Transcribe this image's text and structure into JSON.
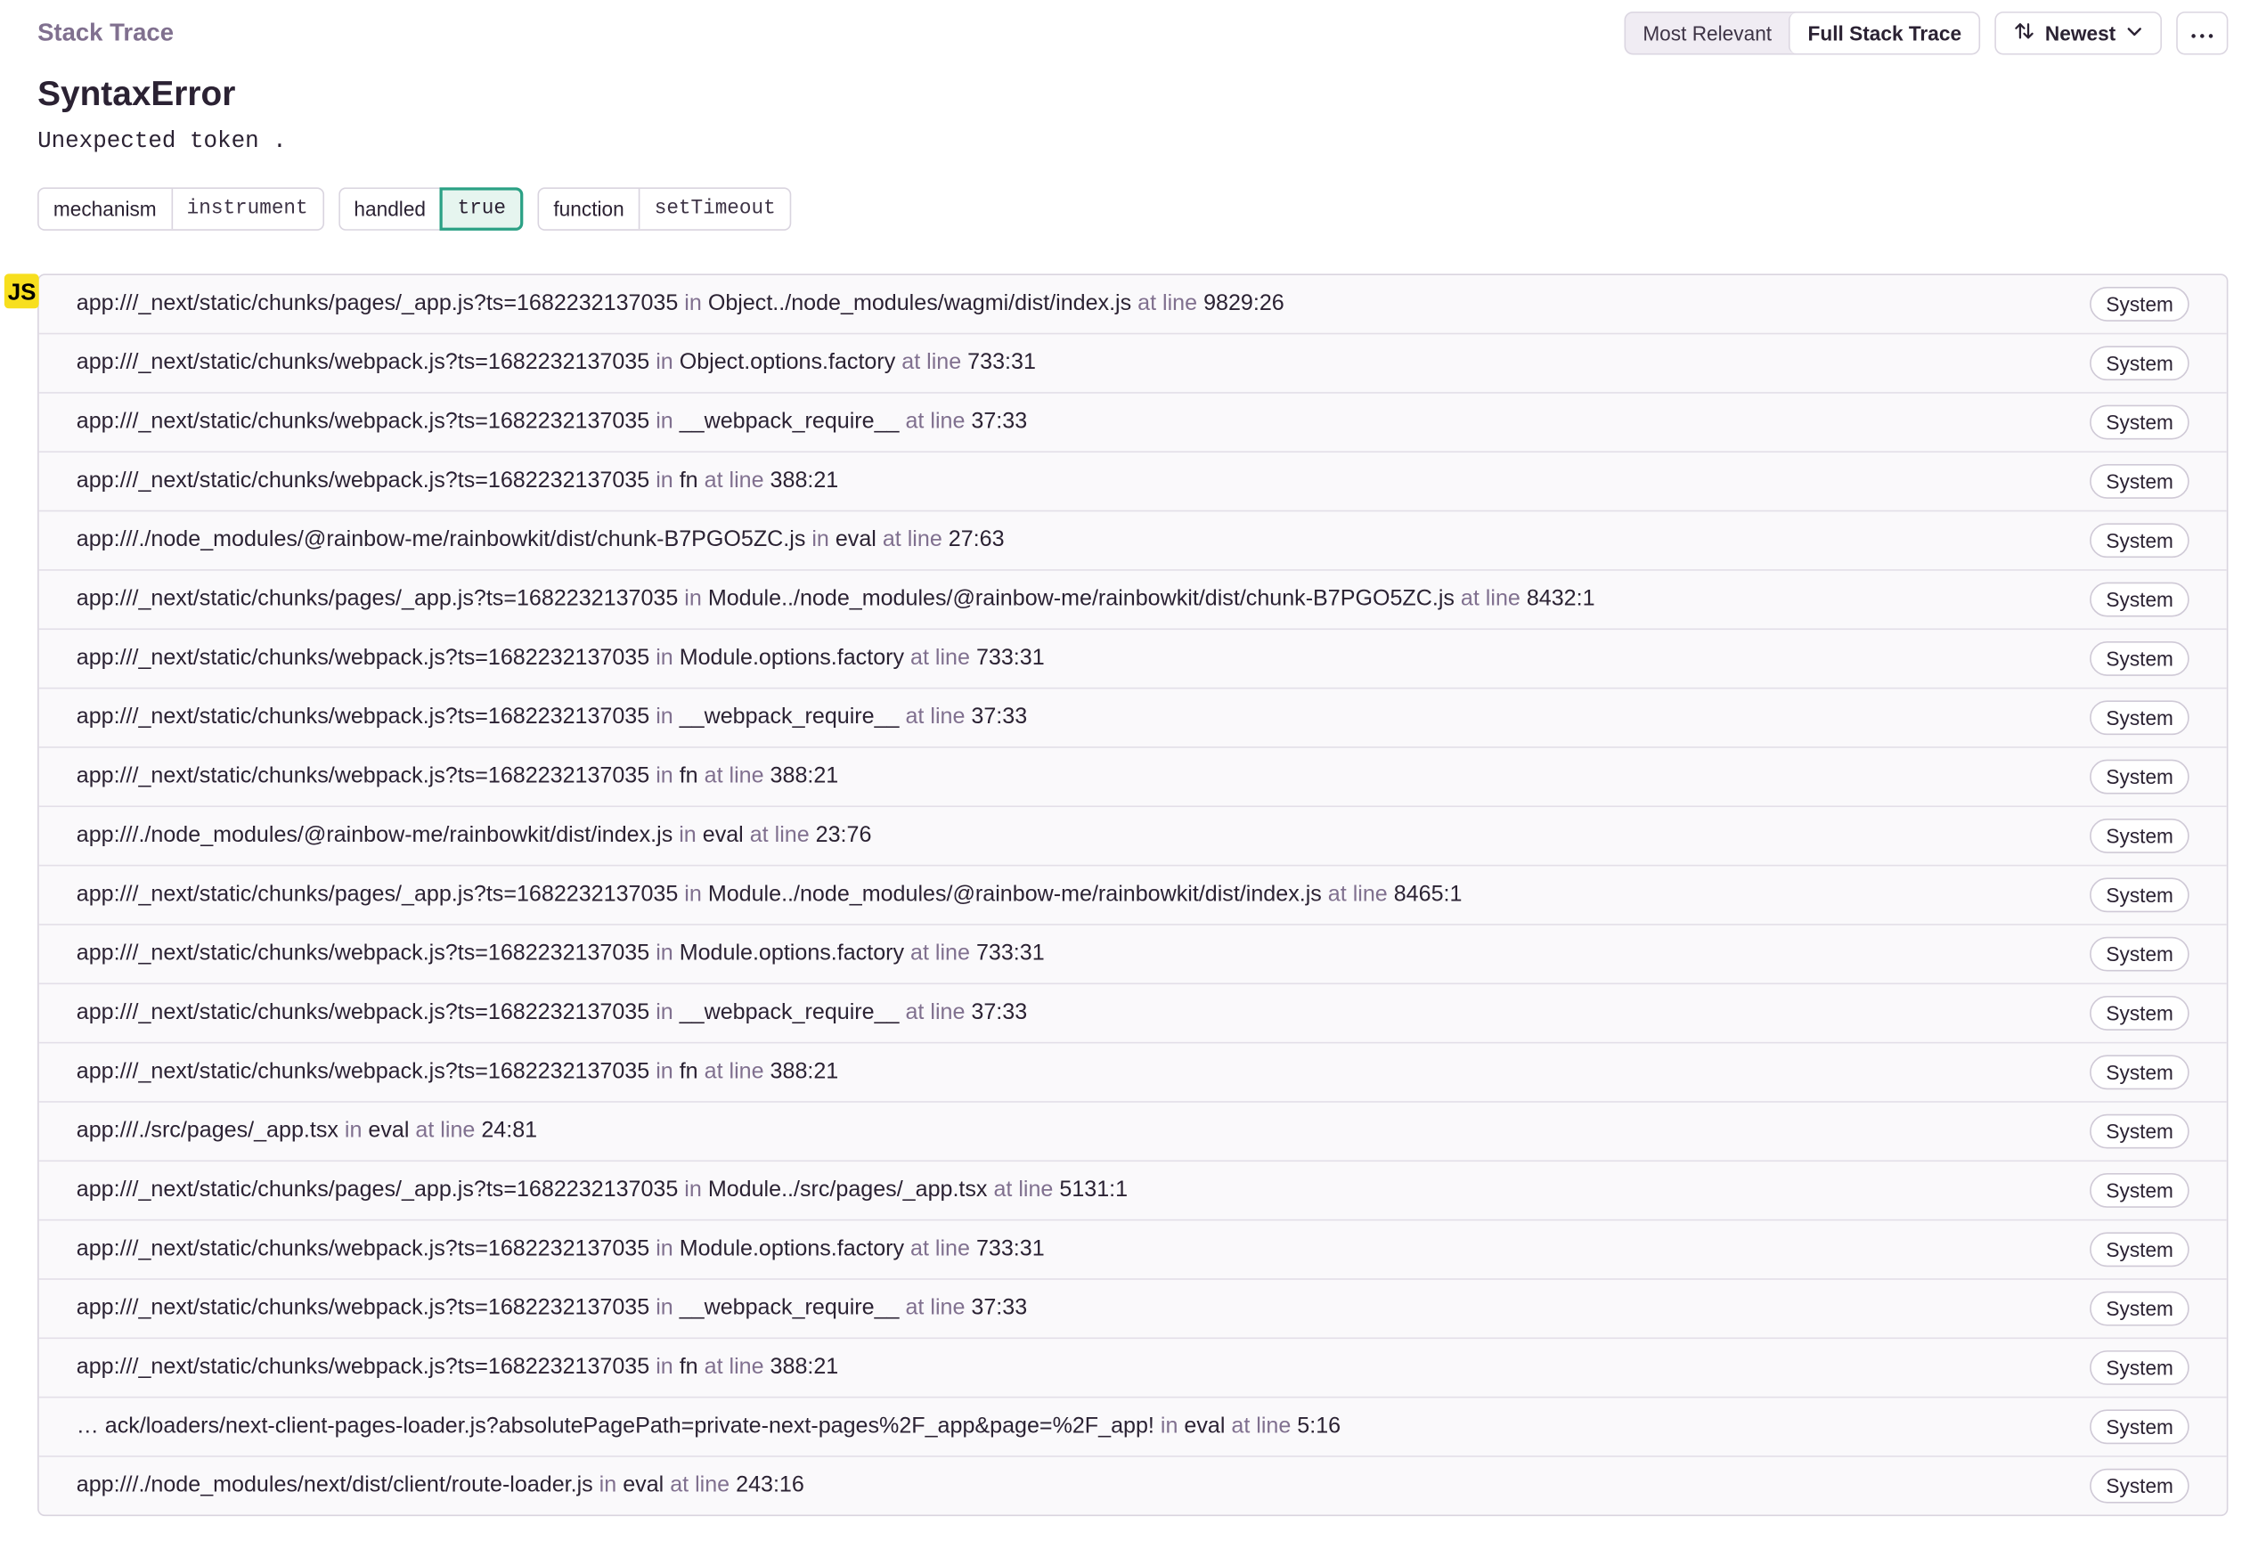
{
  "header": {
    "section_title": "Stack Trace",
    "view_toggle": {
      "options": [
        "Most Relevant",
        "Full Stack Trace"
      ],
      "selected": "Full Stack Trace"
    },
    "sort_label": "Newest",
    "more_icon": "ellipsis-icon",
    "sort_icon": "sort-arrows-icon"
  },
  "exception": {
    "type": "SyntaxError",
    "value": "Unexpected token ."
  },
  "tags": [
    {
      "key": "mechanism",
      "value": "instrument",
      "highlight": false
    },
    {
      "key": "handled",
      "value": "true",
      "highlight": true
    },
    {
      "key": "function",
      "value": "setTimeout",
      "highlight": false
    }
  ],
  "platform_badge": "JS",
  "frame_words": {
    "in": "in",
    "at_line": "at line"
  },
  "frames": [
    {
      "file": "app:///_next/static/chunks/pages/_app.js?ts=1682232137035",
      "function": "Object../node_modules/wagmi/dist/index.js",
      "line": "9829:26",
      "badge": "System"
    },
    {
      "file": "app:///_next/static/chunks/webpack.js?ts=1682232137035",
      "function": "Object.options.factory",
      "line": "733:31",
      "badge": "System"
    },
    {
      "file": "app:///_next/static/chunks/webpack.js?ts=1682232137035",
      "function": "__webpack_require__",
      "line": "37:33",
      "badge": "System"
    },
    {
      "file": "app:///_next/static/chunks/webpack.js?ts=1682232137035",
      "function": "fn",
      "line": "388:21",
      "badge": "System"
    },
    {
      "file": "app:///./node_modules/@rainbow-me/rainbowkit/dist/chunk-B7PGO5ZC.js",
      "function": "eval",
      "line": "27:63",
      "badge": "System"
    },
    {
      "file": "app:///_next/static/chunks/pages/_app.js?ts=1682232137035",
      "function": "Module../node_modules/@rainbow-me/rainbowkit/dist/chunk-B7PGO5ZC.js",
      "line": "8432:1",
      "badge": "System"
    },
    {
      "file": "app:///_next/static/chunks/webpack.js?ts=1682232137035",
      "function": "Module.options.factory",
      "line": "733:31",
      "badge": "System"
    },
    {
      "file": "app:///_next/static/chunks/webpack.js?ts=1682232137035",
      "function": "__webpack_require__",
      "line": "37:33",
      "badge": "System"
    },
    {
      "file": "app:///_next/static/chunks/webpack.js?ts=1682232137035",
      "function": "fn",
      "line": "388:21",
      "badge": "System"
    },
    {
      "file": "app:///./node_modules/@rainbow-me/rainbowkit/dist/index.js",
      "function": "eval",
      "line": "23:76",
      "badge": "System"
    },
    {
      "file": "app:///_next/static/chunks/pages/_app.js?ts=1682232137035",
      "function": "Module../node_modules/@rainbow-me/rainbowkit/dist/index.js",
      "line": "8465:1",
      "badge": "System"
    },
    {
      "file": "app:///_next/static/chunks/webpack.js?ts=1682232137035",
      "function": "Module.options.factory",
      "line": "733:31",
      "badge": "System"
    },
    {
      "file": "app:///_next/static/chunks/webpack.js?ts=1682232137035",
      "function": "__webpack_require__",
      "line": "37:33",
      "badge": "System"
    },
    {
      "file": "app:///_next/static/chunks/webpack.js?ts=1682232137035",
      "function": "fn",
      "line": "388:21",
      "badge": "System"
    },
    {
      "file": "app:///./src/pages/_app.tsx",
      "function": "eval",
      "line": "24:81",
      "badge": "System"
    },
    {
      "file": "app:///_next/static/chunks/pages/_app.js?ts=1682232137035",
      "function": "Module../src/pages/_app.tsx",
      "line": "5131:1",
      "badge": "System"
    },
    {
      "file": "app:///_next/static/chunks/webpack.js?ts=1682232137035",
      "function": "Module.options.factory",
      "line": "733:31",
      "badge": "System"
    },
    {
      "file": "app:///_next/static/chunks/webpack.js?ts=1682232137035",
      "function": "__webpack_require__",
      "line": "37:33",
      "badge": "System"
    },
    {
      "file": "app:///_next/static/chunks/webpack.js?ts=1682232137035",
      "function": "fn",
      "line": "388:21",
      "badge": "System"
    },
    {
      "file": "… ack/loaders/next-client-pages-loader.js?absolutePagePath=private-next-pages%2F_app&page=%2F_app!",
      "function": "eval",
      "line": "5:16",
      "badge": "System"
    },
    {
      "file": "app:///./node_modules/next/dist/client/route-loader.js",
      "function": "eval",
      "line": "243:16",
      "badge": "System"
    }
  ]
}
